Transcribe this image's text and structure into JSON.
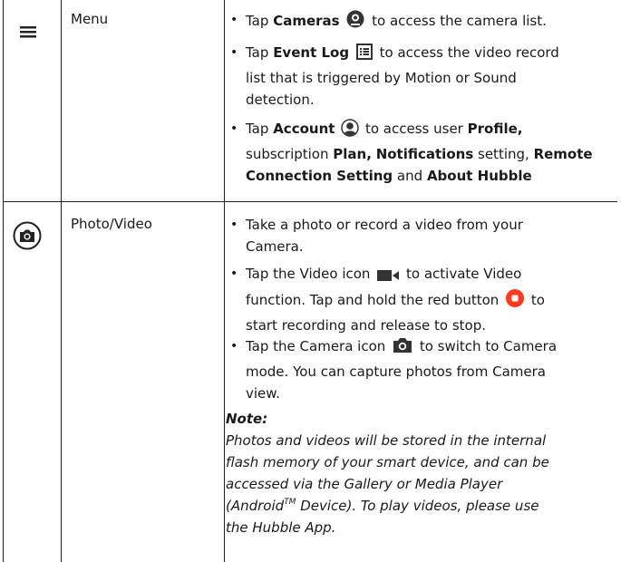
{
  "rows": {
    "menu": {
      "icon": "hamburger-menu-icon",
      "feature": "Menu",
      "b1": {
        "pre": "Tap",
        "bold": "Cameras",
        "post": "to access the camera list.",
        "icon": "camera-list-icon"
      },
      "b2": {
        "pre": "Tap",
        "bold": "Event Log",
        "post1": "to access the video record",
        "line2": "list that is triggered by Motion or Sound",
        "line3": "detection.",
        "icon": "event-log-icon"
      },
      "b3": {
        "pre": "Tap",
        "bold1": "Account",
        "mid1": "to access user",
        "bold2": "Profile,",
        "l2a": "subscription",
        "bold3": "Plan,",
        "bold4": "Notifications",
        "l2b": "setting,",
        "bold5": "Remote",
        "bold6": "Connection Setting",
        "l3a": "and",
        "bold7": "About Hubble",
        "icon": "account-icon"
      }
    },
    "photo": {
      "icon": "camera-circle-icon",
      "feature": "Photo/Video",
      "b1": {
        "line1": "Take a photo or record a video from your",
        "line2": "Camera."
      },
      "b2": {
        "pre": "Tap the Video icon",
        "post": "to activate Video",
        "line2a": "function. Tap and hold the red button",
        "line2b": "to",
        "line3": "start recording and release to stop.",
        "icon": "video-icon",
        "icon2": "record-button-icon"
      },
      "b3": {
        "pre": "Tap the Camera icon",
        "post": "to switch to Camera",
        "line2": "mode. You can capture photos from Camera",
        "line3": "view.",
        "icon": "camera-icon"
      },
      "note": {
        "title": "Note:",
        "l1": "Photos and videos will be stored in the internal",
        "l2": "flash memory of your smart device, and can be",
        "l3": "accessed via the Gallery or Media Player",
        "l4a": "(Android",
        "tm": "TM",
        "l4b": " Device). To play videos, please use",
        "l5": "the Hubble App."
      }
    }
  },
  "colors": {
    "record": "#ff3b1f",
    "border": "#222222",
    "icon": "#333333"
  }
}
